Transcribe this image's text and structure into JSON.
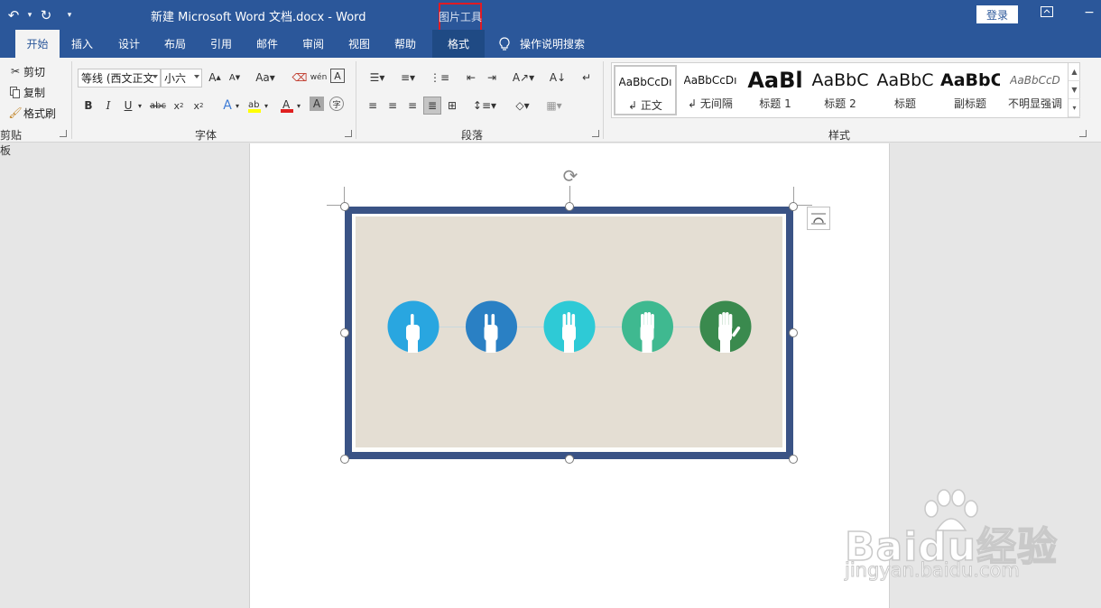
{
  "titlebar": {
    "doc_title": "新建 Microsoft Word 文档.docx  -  Word",
    "context_tab_label": "图片工具",
    "login_label": "登录"
  },
  "tabs": [
    {
      "label": "开始",
      "active": true
    },
    {
      "label": "插入"
    },
    {
      "label": "设计"
    },
    {
      "label": "布局"
    },
    {
      "label": "引用"
    },
    {
      "label": "邮件"
    },
    {
      "label": "审阅"
    },
    {
      "label": "视图"
    },
    {
      "label": "帮助"
    },
    {
      "label": "格式",
      "context": true
    }
  ],
  "tell_me": "操作说明搜索",
  "clipboard": {
    "cut": "剪切",
    "copy": "复制",
    "format_painter": "格式刷",
    "group_label": "剪贴板"
  },
  "font": {
    "font_name": "等线 (西文正文",
    "font_size": "小六",
    "group_label": "字体",
    "font_color": "#e02020",
    "highlight_color": "#ffff00"
  },
  "paragraph": {
    "group_label": "段落"
  },
  "styles": {
    "group_label": "样式",
    "items": [
      {
        "preview": "AaBbCcDı",
        "name": "正文"
      },
      {
        "preview": "AaBbCcDı",
        "name": "无间隔"
      },
      {
        "preview": "AaBl",
        "name": "标题 1"
      },
      {
        "preview": "AaBbC",
        "name": "标题 2"
      },
      {
        "preview": "AaBbC",
        "name": "标题"
      },
      {
        "preview": "AaBbC",
        "name": "副标题"
      },
      {
        "preview": "AaBbCcD",
        "name": "不明显强调"
      }
    ]
  },
  "picture": {
    "frame_color": "#3a5385",
    "paper_color": "#e4ded3",
    "hands": [
      {
        "fingers": 1,
        "color": "#29a6e0"
      },
      {
        "fingers": 2,
        "color": "#2a80c4"
      },
      {
        "fingers": 3,
        "color": "#2ecad6"
      },
      {
        "fingers": 4,
        "color": "#3fb990"
      },
      {
        "fingers": 5,
        "color": "#3a8a4e"
      }
    ]
  },
  "watermark": {
    "brand": "Baidu经验",
    "url": "jingyan.baidu.com"
  }
}
